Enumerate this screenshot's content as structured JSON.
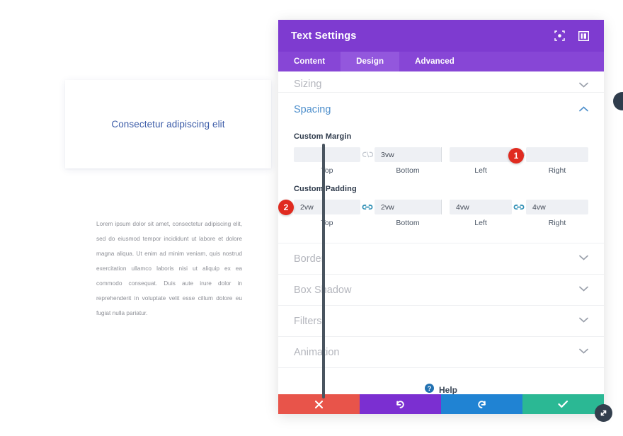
{
  "preview": {
    "heading": "Consectetur adipiscing elit",
    "paragraph": "Lorem ipsum dolor sit amet, consectetur adipiscing elit, sed do eiusmod tempor incididunt ut labore et dolore magna aliqua. Ut enim ad minim veniam, quis nostrud exercitation ullamco laboris nisi ut aliquip ex ea commodo consequat. Duis aute irure dolor in reprehenderit in voluptate velit esse cillum dolore eu fugiat nulla pariatur."
  },
  "modal": {
    "title": "Text Settings",
    "header_icons": [
      {
        "name": "target-expand-icon"
      },
      {
        "name": "layout-columns-icon"
      }
    ],
    "tabs": [
      {
        "label": "Content",
        "active": false
      },
      {
        "label": "Design",
        "active": true
      },
      {
        "label": "Advanced",
        "active": false
      }
    ],
    "sections": {
      "sizing": {
        "label": "Sizing",
        "state": "collapsed",
        "chevron": "⌄"
      },
      "spacing": {
        "label": "Spacing",
        "state": "expanded",
        "chevron": "⌃",
        "margin": {
          "label": "Custom Margin",
          "link_state": "unlinked",
          "fields": [
            {
              "caption": "Top",
              "value": ""
            },
            {
              "caption": "Bottom",
              "value": "3vw"
            },
            {
              "caption": "Left",
              "value": ""
            },
            {
              "caption": "Right",
              "value": ""
            }
          ]
        },
        "padding": {
          "label": "Custom Padding",
          "link_state": "linked",
          "fields": [
            {
              "caption": "Top",
              "value": "2vw"
            },
            {
              "caption": "Bottom",
              "value": "2vw"
            },
            {
              "caption": "Left",
              "value": "4vw"
            },
            {
              "caption": "Right",
              "value": "4vw"
            }
          ]
        }
      },
      "border": {
        "label": "Border",
        "state": "collapsed",
        "chevron": "⌄"
      },
      "box_shadow": {
        "label": "Box Shadow",
        "state": "collapsed",
        "chevron": "⌄"
      },
      "filters": {
        "label": "Filters",
        "state": "collapsed",
        "chevron": "⌄"
      },
      "animation": {
        "label": "Animation",
        "state": "collapsed",
        "chevron": "⌄"
      }
    },
    "help": {
      "label": "Help"
    },
    "footer_buttons": [
      {
        "name": "discard-button",
        "icon": "close-x-icon",
        "color": "#e8544a"
      },
      {
        "name": "undo-button",
        "icon": "undo-icon",
        "color": "#7b2fd1"
      },
      {
        "name": "redo-button",
        "icon": "redo-icon",
        "color": "#2083d3"
      },
      {
        "name": "save-button",
        "icon": "checkmark-icon",
        "color": "#2bb894"
      }
    ]
  },
  "annotations": [
    {
      "number": "1",
      "target": "margin-bottom-field"
    },
    {
      "number": "2",
      "target": "padding-top-field"
    }
  ],
  "colors": {
    "header_purple": "#7e3bd0",
    "tab_bar_purple": "#8746d6",
    "tab_active_purple": "#9357dd",
    "badge_red": "#e02b20",
    "link_active_teal": "#2e8fb5",
    "section_title_blue": "#4e8fcc",
    "heading_blue": "#3c5ca8"
  }
}
